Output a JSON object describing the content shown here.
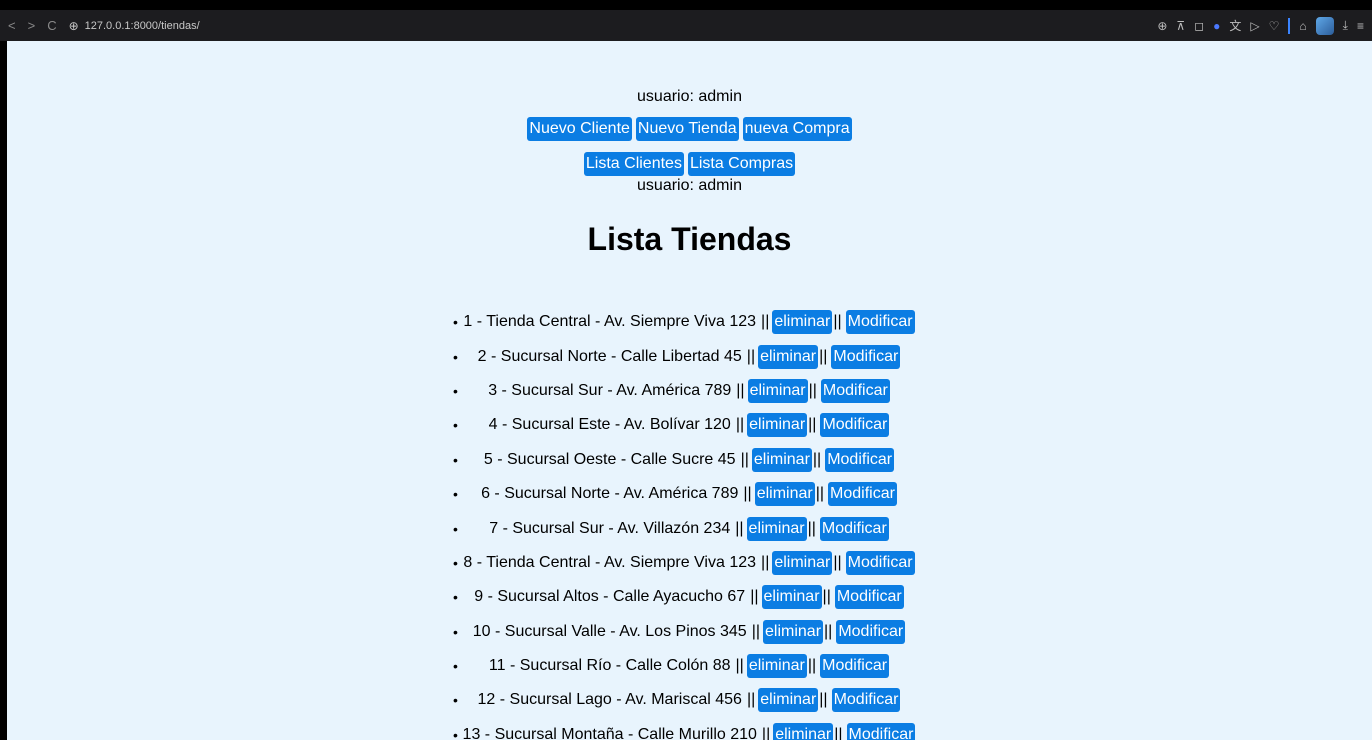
{
  "browser": {
    "url": "127.0.0.1:8000/tiendas/",
    "back": "<",
    "forward": ">",
    "reload": "C"
  },
  "header": {
    "user_top": "usuario: admin",
    "user_bottom": "usuario: admin",
    "nav_row1": [
      "Nuevo Cliente",
      "Nuevo Tienda",
      "nueva Compra"
    ],
    "nav_row2": [
      "Lista Clientes",
      "Lista Compras"
    ]
  },
  "main": {
    "title": "Lista Tiendas",
    "separator": "||",
    "delete_label": "eliminar",
    "edit_label": "Modificar",
    "stores": [
      "1 - Tienda Central - Av. Siempre Viva 123",
      "2 - Sucursal Norte - Calle Libertad 45",
      "3 - Sucursal Sur - Av. América 789",
      "4 - Sucursal Este - Av. Bolívar 120",
      "5 - Sucursal Oeste - Calle Sucre 45",
      "6 - Sucursal Norte - Av. América 789",
      "7 - Sucursal Sur - Av. Villazón 234",
      "8 - Tienda Central - Av. Siempre Viva 123",
      "9 - Sucursal Altos - Calle Ayacucho 67",
      "10 - Sucursal Valle - Av. Los Pinos 345",
      "11 - Sucursal Río - Calle Colón 88",
      "12 - Sucursal Lago - Av. Mariscal 456",
      "13 - Sucursal Montaña - Calle Murillo 210"
    ]
  },
  "colors": {
    "button_bg": "#0b7de3",
    "page_bg": "#e8f4fd"
  }
}
